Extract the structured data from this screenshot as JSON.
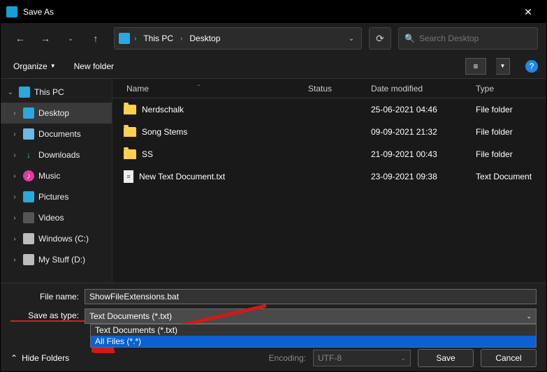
{
  "title": "Save As",
  "breadcrumbs": {
    "root": "This PC",
    "current": "Desktop"
  },
  "search": {
    "placeholder": "Search Desktop"
  },
  "toolbar": {
    "organize": "Organize",
    "newfolder": "New folder"
  },
  "sidebar": {
    "root": "This PC",
    "items": [
      "Desktop",
      "Documents",
      "Downloads",
      "Music",
      "Pictures",
      "Videos",
      "Windows (C:)",
      "My Stuff (D:)"
    ]
  },
  "columns": {
    "name": "Name",
    "status": "Status",
    "date": "Date modified",
    "type": "Type"
  },
  "files": [
    {
      "name": "Nerdschalk",
      "date": "25-06-2021 04:46",
      "type": "File folder",
      "kind": "folder"
    },
    {
      "name": "Song Stems",
      "date": "09-09-2021 21:32",
      "type": "File folder",
      "kind": "folder"
    },
    {
      "name": "SS",
      "date": "21-09-2021 00:43",
      "type": "File folder",
      "kind": "folder"
    },
    {
      "name": "New Text Document.txt",
      "date": "23-09-2021 09:38",
      "type": "Text Document",
      "kind": "file"
    }
  ],
  "fields": {
    "filename_label": "File name:",
    "filename_value": "ShowFileExtensions.bat",
    "type_label": "Save as type:",
    "type_value": "Text Documents (*.txt)",
    "type_options": [
      "Text Documents (*.txt)",
      "All Files  (*.*)"
    ]
  },
  "footer": {
    "hide": "Hide Folders",
    "encoding_label": "Encoding:",
    "encoding_value": "UTF-8",
    "save": "Save",
    "cancel": "Cancel"
  }
}
